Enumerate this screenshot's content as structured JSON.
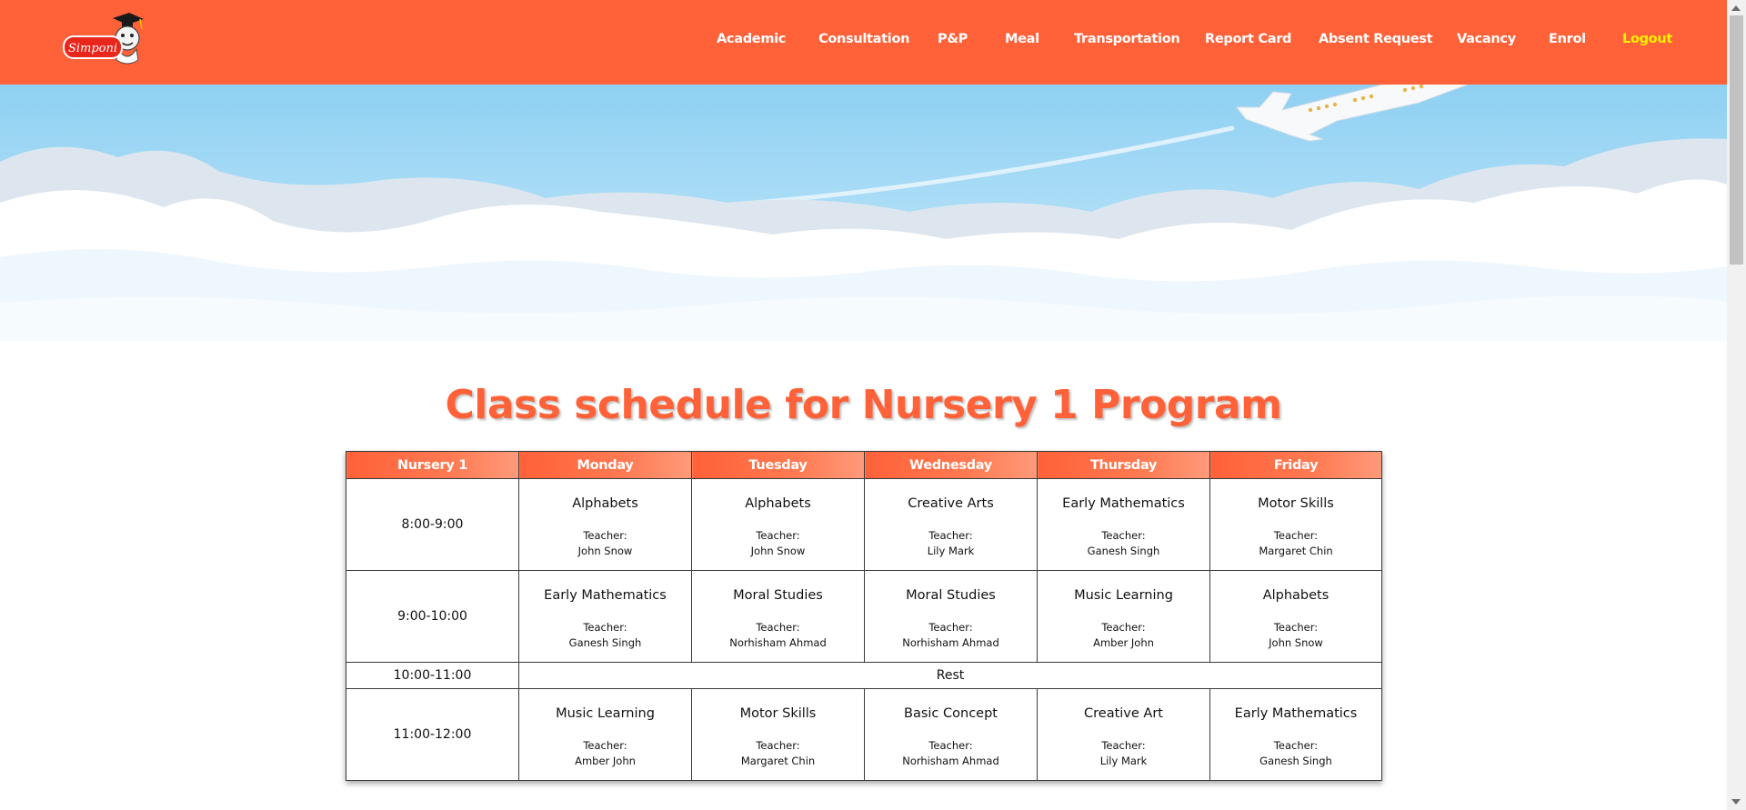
{
  "brand": {
    "logo_text": "Simponi"
  },
  "nav": [
    {
      "label": "Academic"
    },
    {
      "label": "Consultation"
    },
    {
      "label": "P&P"
    },
    {
      "label": "Meal"
    },
    {
      "label": "Transportation"
    },
    {
      "label": "Report Card"
    },
    {
      "label": "Absent Request"
    },
    {
      "label": "Vacancy"
    },
    {
      "label": "Enrol"
    },
    {
      "label": "Logout"
    }
  ],
  "colors": {
    "brand": "#ff6138",
    "logout": "#fff200",
    "sky": "#8fd0f2"
  },
  "page_title": "Class schedule for Nursery 1 Program",
  "schedule": {
    "headers": [
      "Nursery 1",
      "Monday",
      "Tuesday",
      "Wednesday",
      "Thursday",
      "Friday"
    ],
    "teacher_label": "Teacher:",
    "rows": [
      {
        "time": "8:00-9:00",
        "cells": [
          {
            "subject": "Alphabets",
            "teacher": "John Snow"
          },
          {
            "subject": "Alphabets",
            "teacher": "John Snow"
          },
          {
            "subject": "Creative Arts",
            "teacher": "Lily Mark"
          },
          {
            "subject": "Early Mathematics",
            "teacher": "Ganesh Singh"
          },
          {
            "subject": "Motor Skills",
            "teacher": "Margaret Chin"
          }
        ]
      },
      {
        "time": "9:00-10:00",
        "cells": [
          {
            "subject": "Early Mathematics",
            "teacher": "Ganesh Singh"
          },
          {
            "subject": "Moral Studies",
            "teacher": "Norhisham Ahmad"
          },
          {
            "subject": "Moral Studies",
            "teacher": "Norhisham Ahmad"
          },
          {
            "subject": "Music Learning",
            "teacher": "Amber John"
          },
          {
            "subject": "Alphabets",
            "teacher": "John Snow"
          }
        ]
      },
      {
        "time": "10:00-11:00",
        "rest": "Rest"
      },
      {
        "time": "11:00-12:00",
        "cells": [
          {
            "subject": "Music Learning",
            "teacher": "Amber John"
          },
          {
            "subject": "Motor Skills",
            "teacher": "Margaret Chin"
          },
          {
            "subject": "Basic Concept",
            "teacher": "Norhisham Ahmad"
          },
          {
            "subject": "Creative Art",
            "teacher": "Lily Mark"
          },
          {
            "subject": "Early Mathematics",
            "teacher": "Ganesh Singh"
          }
        ]
      }
    ]
  }
}
